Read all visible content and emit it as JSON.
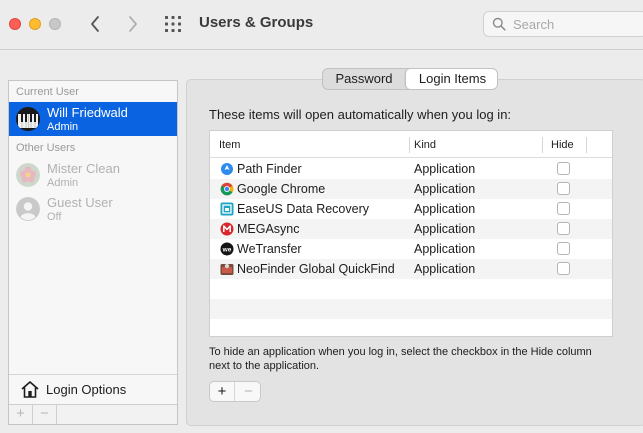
{
  "window": {
    "title": "Users & Groups"
  },
  "search": {
    "placeholder": "Search"
  },
  "users": {
    "current_label": "Current User",
    "other_label": "Other Users",
    "current": {
      "name": "Will Friedwald",
      "role": "Admin"
    },
    "others": [
      {
        "name": "Mister Clean",
        "role": "Admin"
      },
      {
        "name": "Guest User",
        "role": "Off"
      }
    ],
    "login_options": "Login Options",
    "add_symbol": "+",
    "remove_symbol": "−"
  },
  "tabs": {
    "password": "Password",
    "login_items": "Login Items"
  },
  "login_items": {
    "description": "These items will open automatically when you log in:",
    "columns": {
      "item": "Item",
      "kind": "Kind",
      "hide": "Hide"
    },
    "rows": [
      {
        "name": "Path Finder",
        "kind": "Application",
        "icon": "path-finder-icon"
      },
      {
        "name": "Google Chrome",
        "kind": "Application",
        "icon": "chrome-icon"
      },
      {
        "name": "EaseUS Data Recovery",
        "kind": "Application",
        "icon": "easeus-icon"
      },
      {
        "name": "MEGAsync",
        "kind": "Application",
        "icon": "mega-icon"
      },
      {
        "name": "WeTransfer",
        "kind": "Application",
        "icon": "wetransfer-icon"
      },
      {
        "name": "NeoFinder Global QuickFind",
        "kind": "Application",
        "icon": "neofinder-icon"
      }
    ],
    "hint": "To hide an application when you log in, select the checkbox in the Hide column next to the application.",
    "add_symbol": "+",
    "remove_symbol": "−"
  },
  "colors": {
    "selection": "#0a64e1",
    "close": "#ff5f57",
    "minimize": "#febc2e"
  }
}
